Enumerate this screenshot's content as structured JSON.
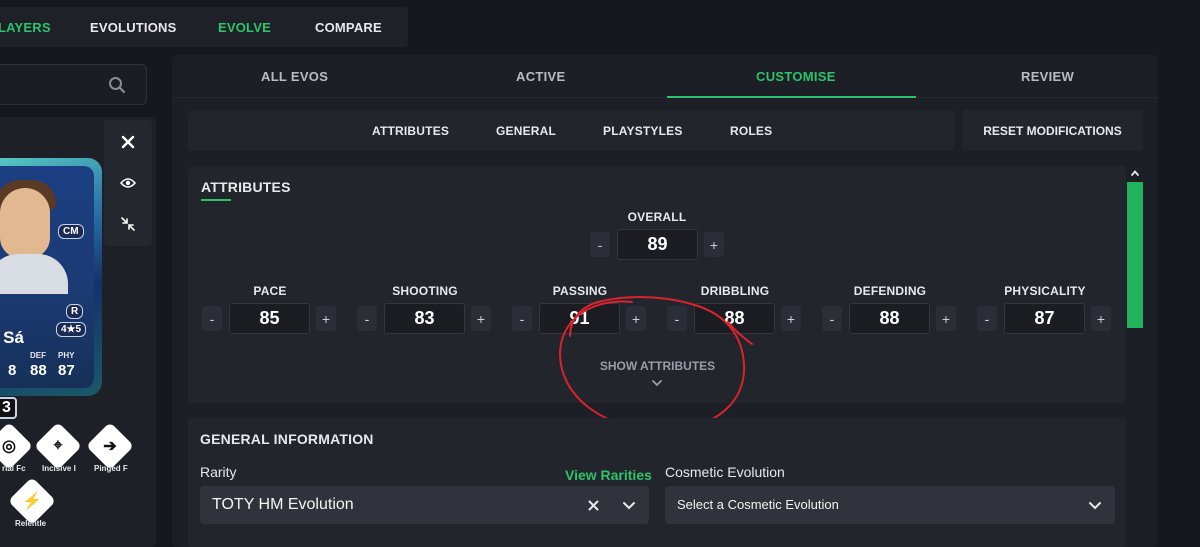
{
  "topnav": {
    "items": [
      "LAYERS",
      "EVOLUTIONS",
      "EVOLVE",
      "COMPARE"
    ]
  },
  "card": {
    "position_badge": "CM",
    "foot_badge": "R",
    "skills_badge": "4★5",
    "name": "o Sá",
    "stats": [
      {
        "label": "DEF",
        "value": "88"
      },
      {
        "label": "PHY",
        "value": "87"
      }
    ],
    "partial_value": "8",
    "rating_fragment": "3"
  },
  "playstyles": [
    {
      "label": "rial Fc",
      "icon": "shield-target-icon"
    },
    {
      "label": "Incisive I",
      "icon": "location-pin-icon"
    },
    {
      "label": "Pinged F",
      "icon": "arrow-pass-icon"
    },
    {
      "label": "Relentle",
      "icon": "battery-bolt-icon"
    }
  ],
  "tabs": [
    "ALL EVOS",
    "ACTIVE",
    "CUSTOMISE",
    "REVIEW"
  ],
  "subnav": [
    "ATTRIBUTES",
    "GENERAL",
    "PLAYSTYLES",
    "ROLES"
  ],
  "reset_label": "RESET MODIFICATIONS",
  "attributes": {
    "title": "ATTRIBUTES",
    "overall_label": "OVERALL",
    "overall_value": "89",
    "stats": [
      {
        "label": "PACE",
        "value": "85"
      },
      {
        "label": "SHOOTING",
        "value": "83"
      },
      {
        "label": "PASSING",
        "value": "91"
      },
      {
        "label": "DRIBBLING",
        "value": "88"
      },
      {
        "label": "DEFENDING",
        "value": "88"
      },
      {
        "label": "PHYSICALITY",
        "value": "87"
      }
    ],
    "minus": "-",
    "plus": "+",
    "show_label": "SHOW ATTRIBUTES"
  },
  "general": {
    "title": "GENERAL INFORMATION",
    "rarity_label": "Rarity",
    "view_rarities": "View Rarities",
    "rarity_value": "TOTY HM Evolution",
    "cosmetic_label": "Cosmetic Evolution",
    "cosmetic_placeholder": "Select a Cosmetic Evolution"
  },
  "colors": {
    "accent": "#2cc36b",
    "annotation": "#d9232e"
  }
}
